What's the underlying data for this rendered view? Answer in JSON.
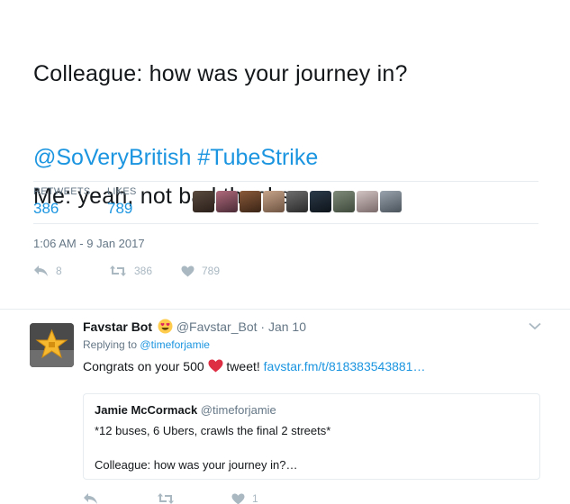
{
  "tweet": {
    "line1": "Colleague: how was your journey in?",
    "line2": "Me: yeah, not bad thanks.",
    "mention": "@SoVeryBritish",
    "hashtag": "#TubeStrike",
    "stats": {
      "retweets_label": "RETWEETS",
      "retweets_value": "386",
      "likes_label": "LIKES",
      "likes_value": "789"
    },
    "liker_avatars": [
      "avatar-1",
      "avatar-2",
      "avatar-3",
      "avatar-4",
      "avatar-5",
      "avatar-6",
      "avatar-7",
      "avatar-8",
      "avatar-9"
    ],
    "timestamp": "1:06 AM - 9 Jan 2017",
    "actions": {
      "reply_count": "8",
      "retweet_count": "386",
      "like_count": "789"
    }
  },
  "reply": {
    "name": "Favstar Bot",
    "emoji": "heart-eyes-emoji",
    "handle": "@Favstar_Bot",
    "separator": "·",
    "date": "Jan 10",
    "replying_prefix": "Replying to",
    "replying_to": "@timeforjamie",
    "text_before": "Congrats on your 500",
    "text_after": "tweet!",
    "link": "favstar.fm/t/818383543881…",
    "quote": {
      "name": "Jamie McCormack",
      "handle": "@timeforjamie",
      "line1": "*12 buses, 6 Ubers, crawls the final 2 streets*",
      "line2": "Colleague: how was your journey in?…"
    },
    "actions": {
      "like_count": "1"
    }
  },
  "colors": {
    "link": "#1b95e0",
    "muted": "#657786",
    "icon": "#aab8c2",
    "heart_red": "#e0245e",
    "border": "#e6ecf0"
  }
}
